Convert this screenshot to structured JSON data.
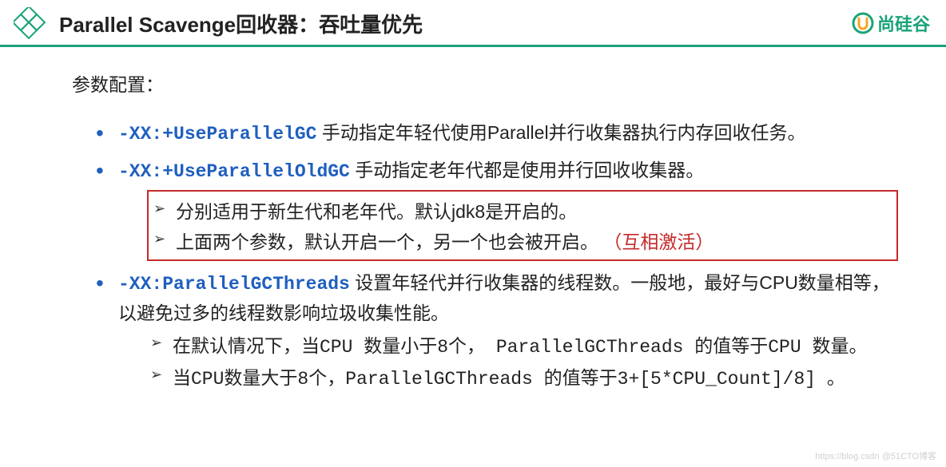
{
  "header": {
    "title": "Parallel Scavenge回收器：吞吐量优先",
    "brand": "尚硅谷"
  },
  "section_label": "参数配置：",
  "items": [
    {
      "flag": "-XX:+UseParallelGC",
      "desc": "  手动指定年轻代使用Parallel并行收集器执行内存回收任务。"
    },
    {
      "flag": "-XX:+UseParallelOldGC",
      "desc": "  手动指定老年代都是使用并行回收收集器。",
      "boxed_sub": [
        {
          "text": "分别适用于新生代和老年代。默认jdk8是开启的。"
        },
        {
          "text": "上面两个参数，默认开启一个，另一个也会被开启。",
          "red": "（互相激活）"
        }
      ]
    },
    {
      "flag": "-XX:ParallelGCThreads",
      "desc": " 设置年轻代并行收集器的线程数。一般地，最好与CPU数量相等，以避免过多的线程数影响垃圾收集性能。",
      "sub": [
        "在默认情况下，当CPU 数量小于8个， ParallelGCThreads 的值等于CPU 数量。",
        "当CPU数量大于8个，ParallelGCThreads 的值等于3+[5*CPU_Count]/8] 。"
      ]
    }
  ],
  "watermark": "https://blog.csdn @51CTO博客"
}
